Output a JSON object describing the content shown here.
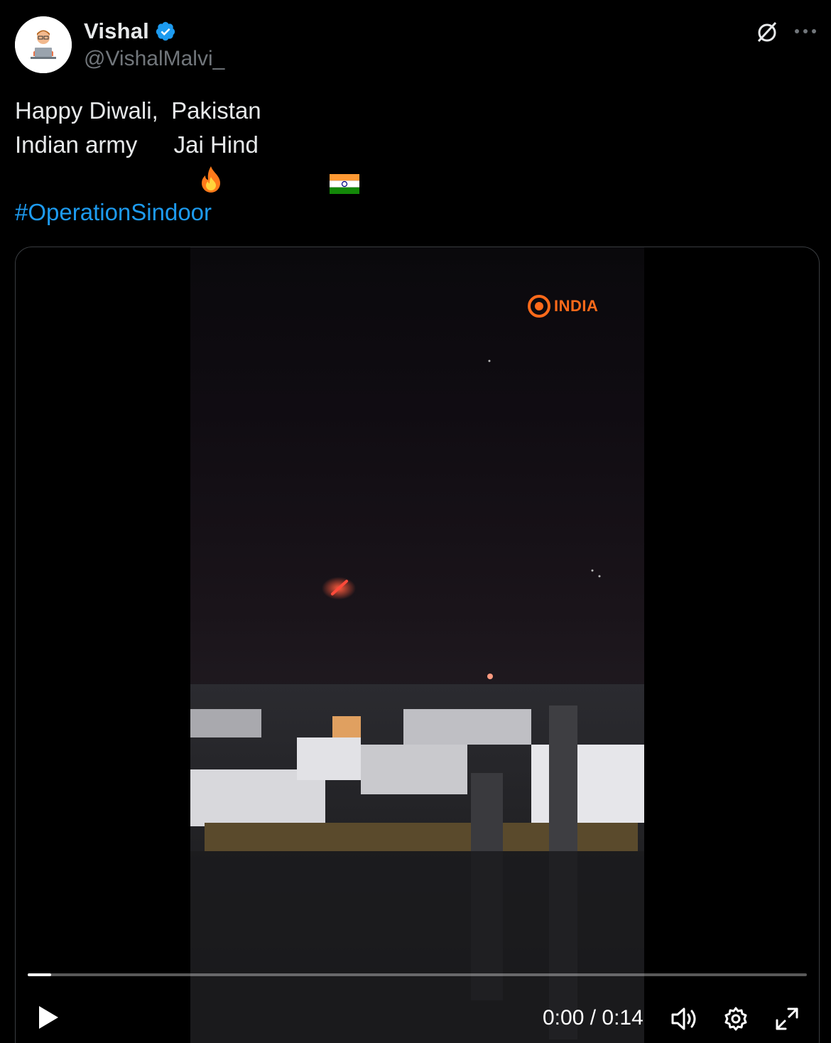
{
  "author": {
    "display_name": "Vishal",
    "handle": "@VishalMalvi_",
    "verified": true,
    "verified_color": "#1d9bf0"
  },
  "header_icons": {
    "grok": "grok-icon",
    "more": "more-icon"
  },
  "tweet": {
    "line1": "Happy Diwali,  Pakistan",
    "line2_before": "Indian army ",
    "line2_emoji": "fire-emoji",
    "line2_after": "Jai Hind ",
    "line2_flag": "india-flag-emoji",
    "hashtag": "#OperationSindoor",
    "hashtag_color": "#1d9bf0"
  },
  "video": {
    "channel_logo": "INDIA",
    "channel_logo_color": "#ff6a1a",
    "current_time": "0:00",
    "separator": " / ",
    "duration": "0:14",
    "progress": 0.03,
    "controls": [
      "play-icon",
      "volume-icon",
      "settings-icon",
      "fullscreen-icon"
    ]
  }
}
